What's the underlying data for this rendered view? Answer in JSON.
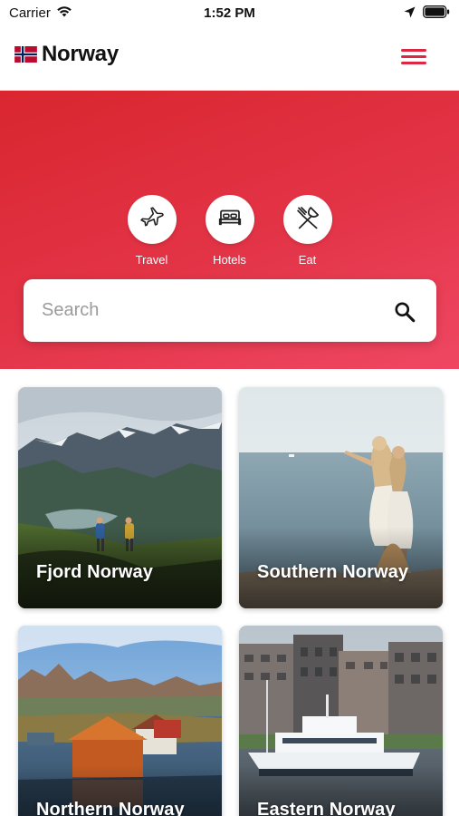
{
  "status_bar": {
    "carrier": "Carrier",
    "time": "1:52 PM"
  },
  "header": {
    "title": "Norway",
    "flag_icon": "norway-flag-icon",
    "menu_icon": "hamburger-menu-icon"
  },
  "categories": [
    {
      "label": "Travel",
      "icon": "airplane-icon"
    },
    {
      "label": "Hotels",
      "icon": "bed-icon"
    },
    {
      "label": "Eat",
      "icon": "fork-knife-icon"
    }
  ],
  "search": {
    "placeholder": "Search",
    "value": "",
    "icon": "search-icon"
  },
  "regions": [
    {
      "name": "Fjord Norway"
    },
    {
      "name": "Southern Norway"
    },
    {
      "name": "Northern Norway"
    },
    {
      "name": "Eastern Norway"
    }
  ],
  "colors": {
    "accent": "#dd2743",
    "hero_start": "#d9262f",
    "hero_end": "#ef4763",
    "flag_red": "#ba0c2f",
    "flag_blue": "#00205b"
  }
}
